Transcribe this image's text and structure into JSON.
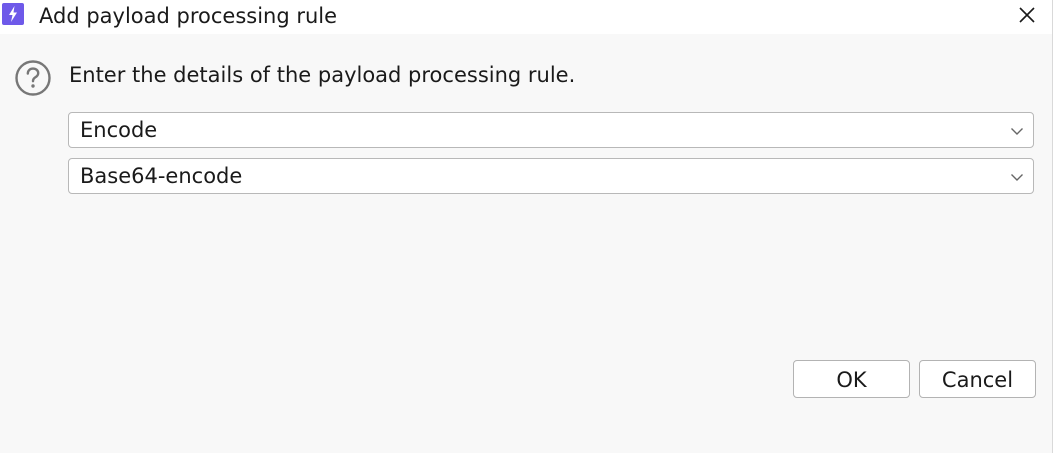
{
  "window": {
    "title": "Add payload processing rule",
    "icon": "burp-app-icon",
    "close_icon": "close-icon"
  },
  "body": {
    "message": "Enter the details of the payload processing rule.",
    "help_icon": "help-icon"
  },
  "rule_type_select": {
    "value": "Encode"
  },
  "encoding_select": {
    "value": "Base64-encode"
  },
  "buttons": {
    "ok_label": "OK",
    "cancel_label": "Cancel"
  },
  "colors": {
    "app_icon_bg": "#6e59e9",
    "dialog_bg": "#f8f8f8",
    "titlebar_bg": "#ffffff"
  }
}
